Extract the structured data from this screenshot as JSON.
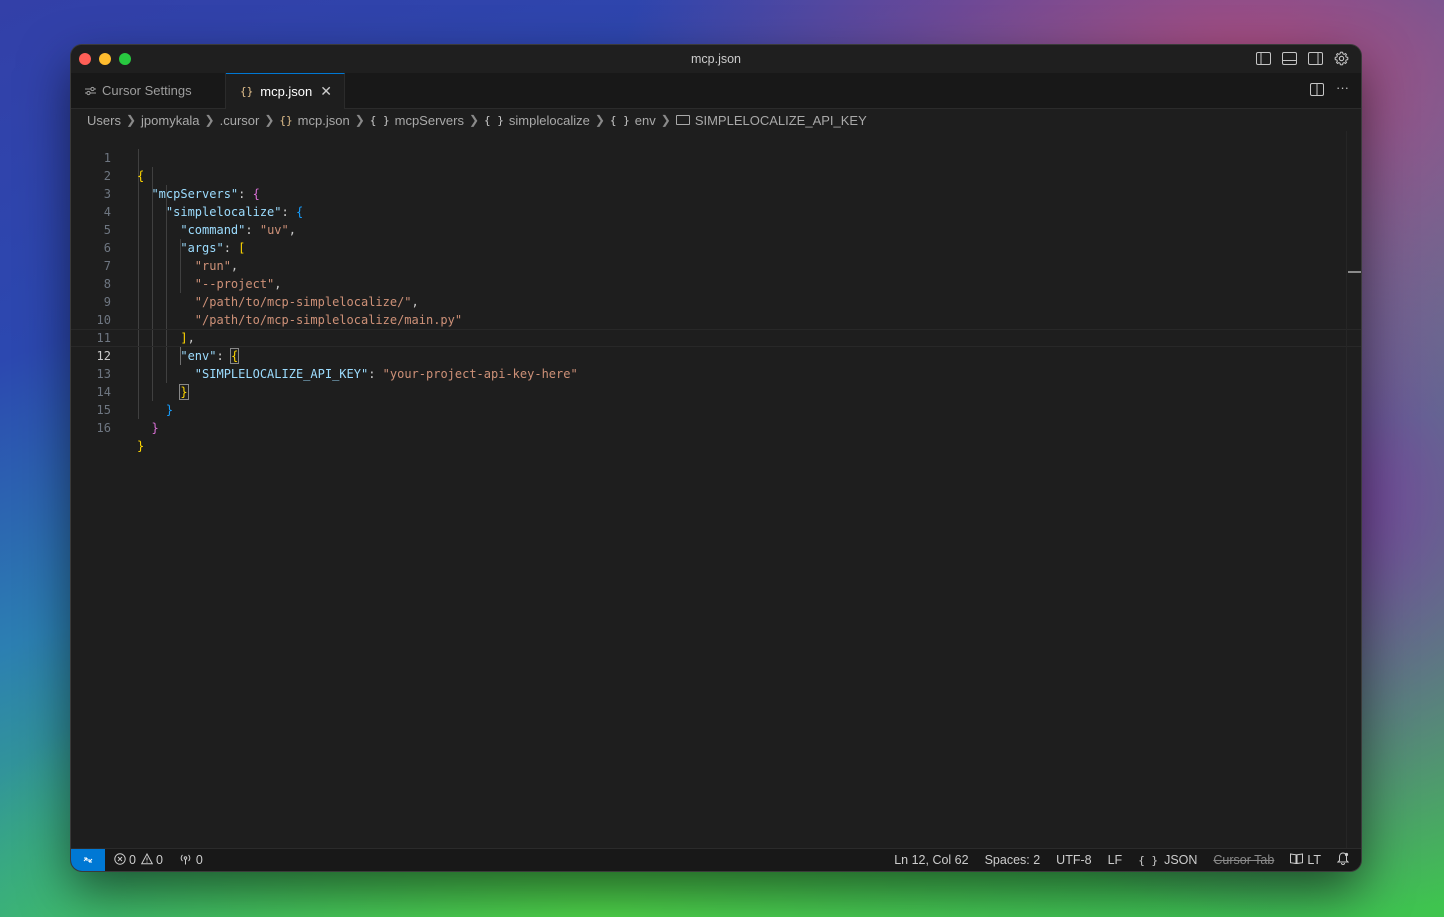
{
  "window": {
    "title": "mcp.json"
  },
  "tabs": [
    {
      "label": "Cursor Settings",
      "icon": "settings-sliders-icon",
      "active": false
    },
    {
      "label": "mcp.json",
      "icon": "json-braces-icon",
      "active": true
    }
  ],
  "breadcrumb": {
    "items": [
      "Users",
      "jpomykala",
      ".cursor",
      "mcp.json",
      "mcpServers",
      "simplelocalize",
      "env",
      "SIMPLELOCALIZE_API_KEY"
    ],
    "icon_braces": "{ }"
  },
  "editor": {
    "current_line": 12,
    "line_numbers": [
      "1",
      "2",
      "3",
      "4",
      "5",
      "6",
      "7",
      "8",
      "9",
      "10",
      "11",
      "12",
      "13",
      "14",
      "15",
      "16"
    ],
    "tokens": {
      "k_mcpServers": "\"mcpServers\"",
      "k_simplelocalize": "\"simplelocalize\"",
      "k_command": "\"command\"",
      "s_uv": "\"uv\"",
      "k_args": "\"args\"",
      "s_run": "\"run\"",
      "s_project": "\"--project\"",
      "s_path1": "\"/path/to/mcp-simplelocalize/\"",
      "s_path2": "\"/path/to/mcp-simplelocalize/main.py\"",
      "k_env": "\"env\"",
      "k_api": "\"SIMPLELOCALIZE_API_KEY\"",
      "s_api": "\"your-project-api-key-here\"",
      "colon": ": ",
      "comma": ",",
      "lbrace": "{",
      "rbrace": "}",
      "lbracket": "[",
      "rbracket": "]"
    }
  },
  "statusbar": {
    "errors": "0",
    "warnings": "0",
    "ports": "0",
    "position": "Ln 12, Col 62",
    "spaces": "Spaces: 2",
    "encoding": "UTF-8",
    "eol": "LF",
    "language": "JSON",
    "language_icon": "{ }",
    "cursor_tab": "Cursor Tab",
    "lt": "LT"
  },
  "colors": {
    "accent": "#0078d4",
    "json_key": "#9cdcfe",
    "json_string": "#ce9178",
    "bracket_level1": "#ffd700",
    "bracket_level2": "#da70d6",
    "bracket_level3": "#179fff"
  }
}
